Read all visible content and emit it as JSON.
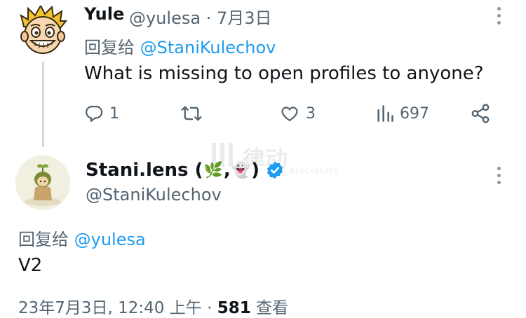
{
  "tweet1": {
    "display_name": "Yule",
    "handle": "@yulesa",
    "separator": "·",
    "date": "7月3日",
    "replying_to_label": "回复给",
    "replying_to_handle": "@StaniKulechov",
    "text": "What is missing to open profiles to anyone?",
    "actions": {
      "replies": "1",
      "retweets": "",
      "likes": "3",
      "views": "697"
    }
  },
  "tweet2": {
    "display_name": "Stani.lens (",
    "name_emoji_1": "🌿",
    "name_comma": ",",
    "name_emoji_2": "👻",
    "name_close": ")",
    "handle": "@StaniKulechov",
    "replying_to_label": "回复给",
    "replying_to_handle": "@yulesa",
    "text": "V2",
    "timestamp": "23年7月3日, 12:40 上午",
    "separator": "·",
    "views_count": "581",
    "views_label": "查看"
  },
  "watermark": {
    "text": "律动",
    "sub": "BLOCKBEATS"
  },
  "colors": {
    "text_primary": "#0f1419",
    "text_secondary": "#536471",
    "accent": "#1d9bf0",
    "thread_line": "#cfd9de"
  },
  "icons": [
    "reply-icon",
    "retweet-icon",
    "like-icon",
    "views-icon",
    "share-icon",
    "more-icon",
    "verified-icon"
  ]
}
